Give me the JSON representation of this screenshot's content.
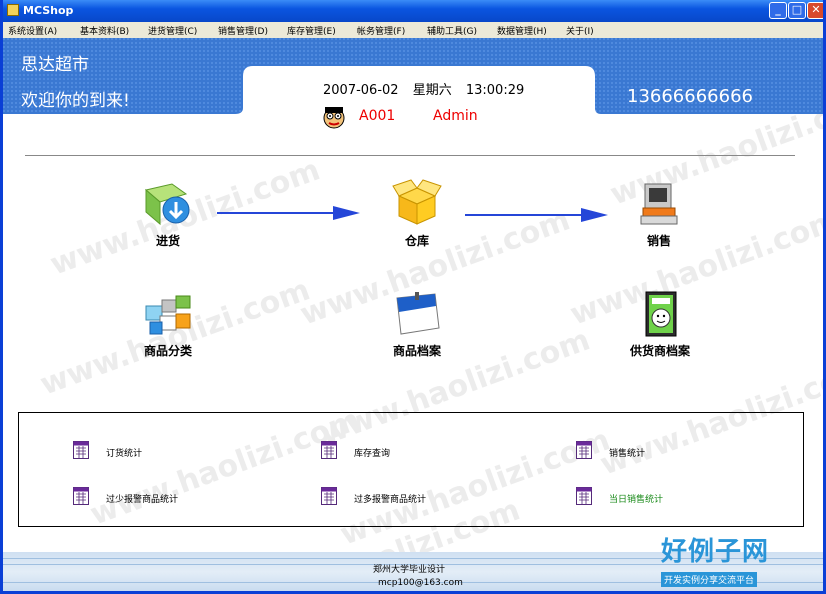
{
  "window": {
    "title": "MCShop",
    "minimize": "_",
    "maximize": "□",
    "close": "✕"
  },
  "menu": [
    {
      "label": "系统设置(A)"
    },
    {
      "label": "基本资料(B)"
    },
    {
      "label": "进货管理(C)"
    },
    {
      "label": "销售管理(D)"
    },
    {
      "label": "库存管理(E)"
    },
    {
      "label": "帐务管理(F)"
    },
    {
      "label": "辅助工具(G)"
    },
    {
      "label": "数据管理(H)"
    },
    {
      "label": "关于(I)"
    }
  ],
  "banner": {
    "store_name": "思达超市",
    "welcome": "欢迎你的到来!",
    "date": "2007-06-02",
    "weekday": "星期六",
    "time": "13:00:29",
    "user_code": "A001",
    "user_name": "Admin",
    "phone": "13666666666"
  },
  "modules": {
    "purchase": {
      "label": "进货",
      "icon": "purchase-icon"
    },
    "warehouse": {
      "label": "仓库",
      "icon": "box-icon"
    },
    "sales": {
      "label": "销售",
      "icon": "computer-icon"
    },
    "category": {
      "label": "商品分类",
      "icon": "cubes-icon"
    },
    "product_archive": {
      "label": "商品档案",
      "icon": "notebook-icon"
    },
    "supplier_archive": {
      "label": "供货商档案",
      "icon": "book-icon"
    }
  },
  "quick_links": [
    {
      "label": "订货统计"
    },
    {
      "label": "库存查询"
    },
    {
      "label": "销售统计"
    },
    {
      "label": "过少报警商品统计"
    },
    {
      "label": "过多报警商品统计"
    },
    {
      "label": "当日销售统计"
    }
  ],
  "footer": {
    "line1": "郑州大学毕业设计",
    "line2": "mcp100@163.com"
  },
  "watermark": {
    "text": "www.haolizi.com",
    "logo_big": "好例子网",
    "logo_small": "开发实例分享交流平台"
  },
  "colors": {
    "titlebar": "#0a55e0",
    "banner": "#3c7bd4",
    "accent_red": "#e00000",
    "arrow": "#2546d8",
    "green_link": "#1a8a1a"
  }
}
